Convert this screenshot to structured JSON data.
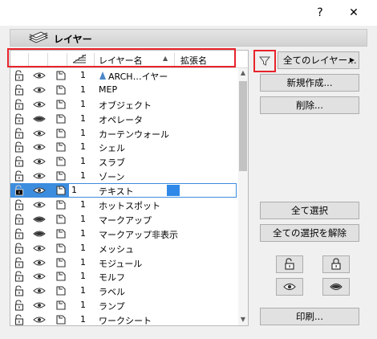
{
  "window": {
    "help_label": "?",
    "close_label": "✕"
  },
  "section": {
    "title": "レイヤー",
    "icon": "layers-icon"
  },
  "columns": {
    "name_header": "レイヤー名",
    "ext_header": "拡張名",
    "sort_indicator": "▲",
    "intersection_icon": "intersection-group-icon"
  },
  "layers": [
    {
      "lock": "unlocked",
      "vis": "shown",
      "mode": "3d",
      "num": "1",
      "name": "ARCH…イヤー",
      "archicad_icon": true
    },
    {
      "lock": "unlocked",
      "vis": "shown",
      "mode": "3d",
      "num": "1",
      "name": "MEP"
    },
    {
      "lock": "unlocked",
      "vis": "shown",
      "mode": "3d",
      "num": "1",
      "name": "オブジェクト"
    },
    {
      "lock": "unlocked",
      "vis": "hidden",
      "mode": "3d",
      "num": "1",
      "name": "オペレータ"
    },
    {
      "lock": "unlocked",
      "vis": "shown",
      "mode": "3d",
      "num": "1",
      "name": "カーテンウォール"
    },
    {
      "lock": "unlocked",
      "vis": "shown",
      "mode": "3d",
      "num": "1",
      "name": "シェル"
    },
    {
      "lock": "unlocked",
      "vis": "shown",
      "mode": "3d",
      "num": "1",
      "name": "スラブ"
    },
    {
      "lock": "unlocked",
      "vis": "shown",
      "mode": "3d",
      "num": "1",
      "name": "ゾーン"
    },
    {
      "lock": "unlocked",
      "vis": "shown",
      "mode": "3d",
      "num": "1",
      "name": "テキスト",
      "selected": true
    },
    {
      "lock": "unlocked",
      "vis": "shown",
      "mode": "3d",
      "num": "1",
      "name": "ホットスポット"
    },
    {
      "lock": "unlocked",
      "vis": "hidden",
      "mode": "3d",
      "num": "1",
      "name": "マークアップ"
    },
    {
      "lock": "unlocked",
      "vis": "hidden",
      "mode": "3d",
      "num": "1",
      "name": "マークアップ非表示"
    },
    {
      "lock": "unlocked",
      "vis": "shown",
      "mode": "3d",
      "num": "1",
      "name": "メッシュ"
    },
    {
      "lock": "unlocked",
      "vis": "shown",
      "mode": "3d",
      "num": "1",
      "name": "モジュール"
    },
    {
      "lock": "unlocked",
      "vis": "shown",
      "mode": "3d",
      "num": "1",
      "name": "モルフ"
    },
    {
      "lock": "unlocked",
      "vis": "shown",
      "mode": "3d",
      "num": "1",
      "name": "ラベル"
    },
    {
      "lock": "unlocked",
      "vis": "shown",
      "mode": "3d",
      "num": "1",
      "name": "ランプ"
    },
    {
      "lock": "unlocked",
      "vis": "shown",
      "mode": "3d",
      "num": "1",
      "name": "ワークシート"
    }
  ],
  "right_panel": {
    "filter_icon": "filter-icon",
    "all_layers_label": "全てのレイヤー…",
    "new_label": "新規作成...",
    "delete_label": "削除...",
    "select_all_label": "全て選択",
    "deselect_all_label": "全ての選択を解除",
    "print_label": "印刷..."
  },
  "colors": {
    "selection": "#3d8ddf",
    "highlight_outline": "#e8232b"
  }
}
